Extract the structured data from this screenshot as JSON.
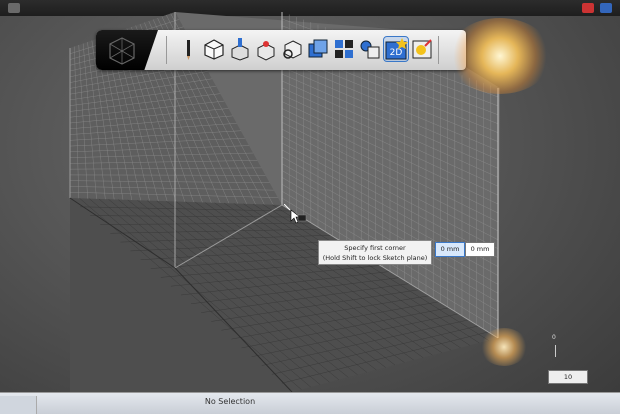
{
  "toolbar": {
    "tools": [
      {
        "name": "pencil-icon"
      },
      {
        "name": "box-primitive-icon"
      },
      {
        "name": "extrude-icon"
      },
      {
        "name": "pull-icon"
      },
      {
        "name": "tweak-icon"
      },
      {
        "name": "combine-icon"
      },
      {
        "name": "pattern-icon"
      },
      {
        "name": "group-icon"
      },
      {
        "name": "sketch-2d-icon",
        "label": "2D"
      },
      {
        "name": "material-icon"
      }
    ]
  },
  "prompt": {
    "line1": "Specify first corner",
    "line2": "(Hold Shift to lock Sketch plane)",
    "x_value": "0 mm",
    "y_value": "0 mm"
  },
  "ruler": {
    "zero_label": "0",
    "zoom_value": "10"
  },
  "status": {
    "selection_text": "No Selection"
  },
  "colors": {
    "viewport_bg": "#555555",
    "grid_line": "#8a8a8a",
    "accent": "#3a78c8"
  }
}
